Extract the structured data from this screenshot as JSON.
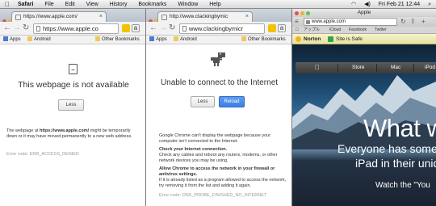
{
  "menubar": {
    "apple": "",
    "menus": [
      "Safari",
      "File",
      "Edit",
      "View",
      "History",
      "Bookmarks",
      "Window",
      "Help"
    ],
    "clock": "Fri Feb 21  12:44"
  },
  "win1": {
    "tab_title": "https://www.apple.com/",
    "url": "https://www.apple.co",
    "bookmarks": {
      "apps": "Apps",
      "android": "Android",
      "other": "Other Bookmarks"
    },
    "heading": "This webpage is not available",
    "less_button": "Less",
    "description_prefix": "The webpage at ",
    "description_url": "https://www.apple.com/",
    "description_suffix": " might be temporarily down or it may have moved permanently to a new web address.",
    "error_code": "Error code: ERR_ACCESS_DENIED"
  },
  "win2": {
    "tab_title": "http://www.clackingbymic",
    "url": "www.clackingbymicr",
    "bookmarks": {
      "apps": "Apps",
      "android": "Android",
      "other": "Other Bookmarks"
    },
    "heading": "Unable to connect to the Internet",
    "less_button": "Less",
    "reload_button": "Reload",
    "intro": "Google Chrome can't display the webpage because your computer isn't connected to the Internet.",
    "check_title": "Check your Internet connection.",
    "check_body": "Check any cables and reboot any routers, modems, or other network devices you may be using.",
    "allow_title": "Allow Chrome to access the network in your firewall or antivirus settings.",
    "allow_body": "If it is already listed as a program allowed to access the network, try removing it from the list and adding it again.",
    "error_code": "Error code: DNS_PROBE_FINISHED_NO_INTERNET"
  },
  "safari": {
    "title": "Apple",
    "url": "www.apple.com",
    "bookmarks": [
      "アップル",
      "iCloud",
      "Facebook",
      "Twitter"
    ],
    "norton": "Norton",
    "site_safe": "Site is Safe",
    "nav": [
      "Store",
      "Mac",
      "iPod"
    ],
    "hero_big": "What w",
    "hero_line1": "Everyone has somethi",
    "hero_line2": "iPad in their uniqu",
    "hero_watch": "Watch the \"You"
  }
}
